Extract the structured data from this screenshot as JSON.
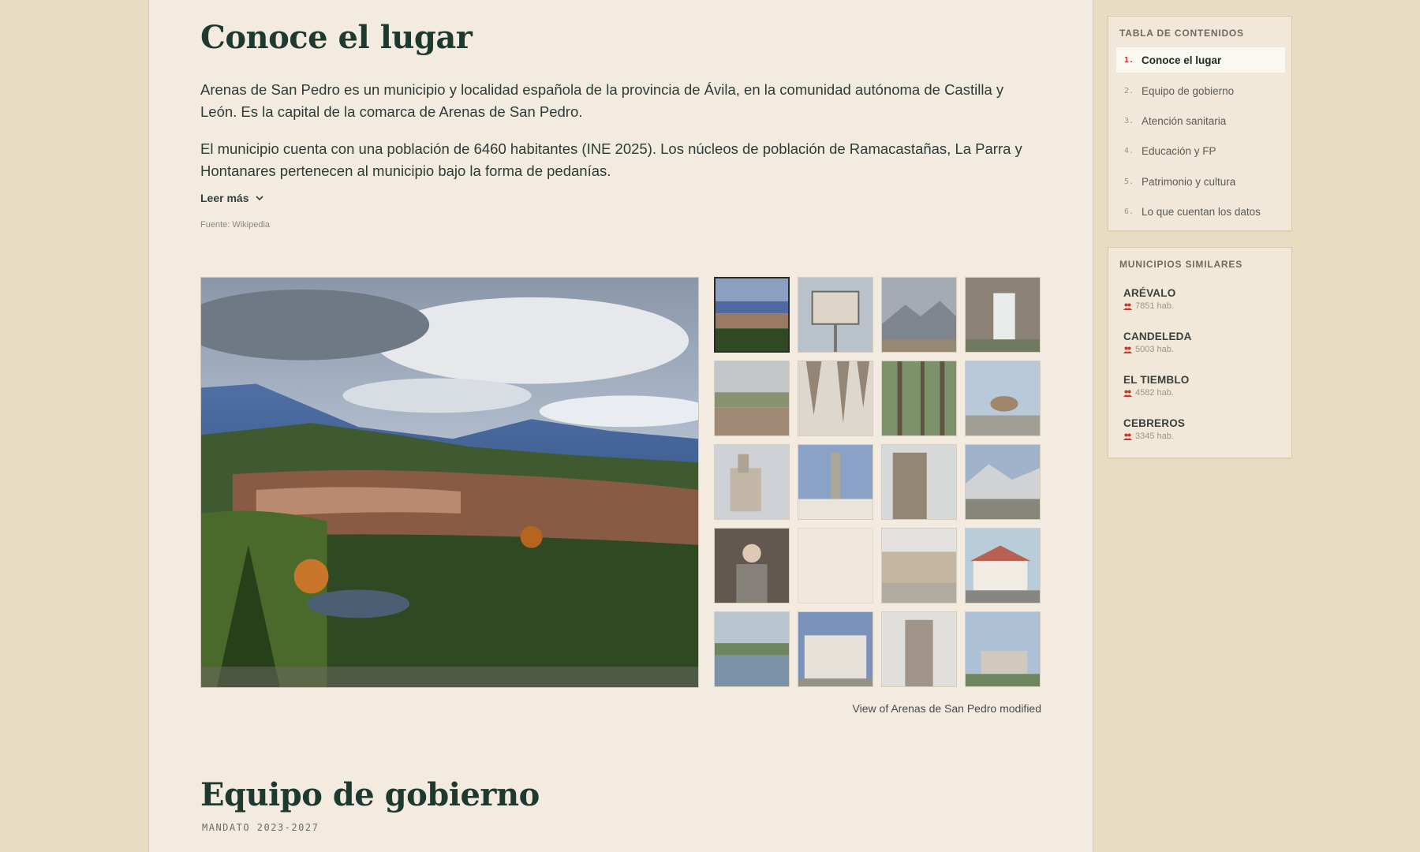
{
  "section1": {
    "title": "Conoce el lugar",
    "p1": "Arenas de San Pedro es un municipio y localidad española de la provincia de Ávila, en la comunidad autónoma de Castilla y León. Es la capital de la comarca de Arenas de San Pedro.",
    "p2": "El municipio cuenta con una población de 6460 habitantes (INE 2025). Los núcleos de población de Ramacastañas, La Parra y Hontanares pertenecen al municipio bajo la forma de pedanías.",
    "read_more": "Leer más",
    "source": "Fuente: Wikipedia"
  },
  "gallery": {
    "caption": "View of Arenas de San Pedro modified",
    "thumbnails": [
      {
        "name": "thumb-town-view"
      },
      {
        "name": "thumb-sign"
      },
      {
        "name": "thumb-mountains"
      },
      {
        "name": "thumb-waterfall"
      },
      {
        "name": "thumb-village"
      },
      {
        "name": "thumb-cave"
      },
      {
        "name": "thumb-forest"
      },
      {
        "name": "thumb-ibex"
      },
      {
        "name": "thumb-church"
      },
      {
        "name": "thumb-column"
      },
      {
        "name": "thumb-tower"
      },
      {
        "name": "thumb-snowy-peaks"
      },
      {
        "name": "thumb-portrait"
      },
      {
        "name": "thumb-empty"
      },
      {
        "name": "thumb-arcade"
      },
      {
        "name": "thumb-house"
      },
      {
        "name": "thumb-lake"
      },
      {
        "name": "thumb-palace"
      },
      {
        "name": "thumb-castle"
      },
      {
        "name": "thumb-estate"
      }
    ]
  },
  "section2": {
    "title": "Equipo de gobierno",
    "subtitle": "MANDATO 2023-2027"
  },
  "toc": {
    "title": "TABLA DE CONTENIDOS",
    "items": [
      {
        "num": "1.",
        "label": "Conoce el lugar"
      },
      {
        "num": "2.",
        "label": "Equipo de gobierno"
      },
      {
        "num": "3.",
        "label": "Atención sanitaria"
      },
      {
        "num": "4.",
        "label": "Educación y FP"
      },
      {
        "num": "5.",
        "label": "Patrimonio y cultura"
      },
      {
        "num": "6.",
        "label": "Lo que cuentan los datos"
      }
    ]
  },
  "similar": {
    "title": "MUNICIPIOS SIMILARES",
    "items": [
      {
        "name": "ARÉVALO",
        "pop": "7851 hab."
      },
      {
        "name": "CANDELEDA",
        "pop": "5003 hab."
      },
      {
        "name": "EL TIEMBLO",
        "pop": "4582 hab."
      },
      {
        "name": "CEBREROS",
        "pop": "3345 hab."
      }
    ]
  },
  "colors": {
    "page_bg": "#e8dcc3",
    "content_bg": "#f3ebe0",
    "heading": "#1e3a2e",
    "accent": "#c0392b"
  }
}
